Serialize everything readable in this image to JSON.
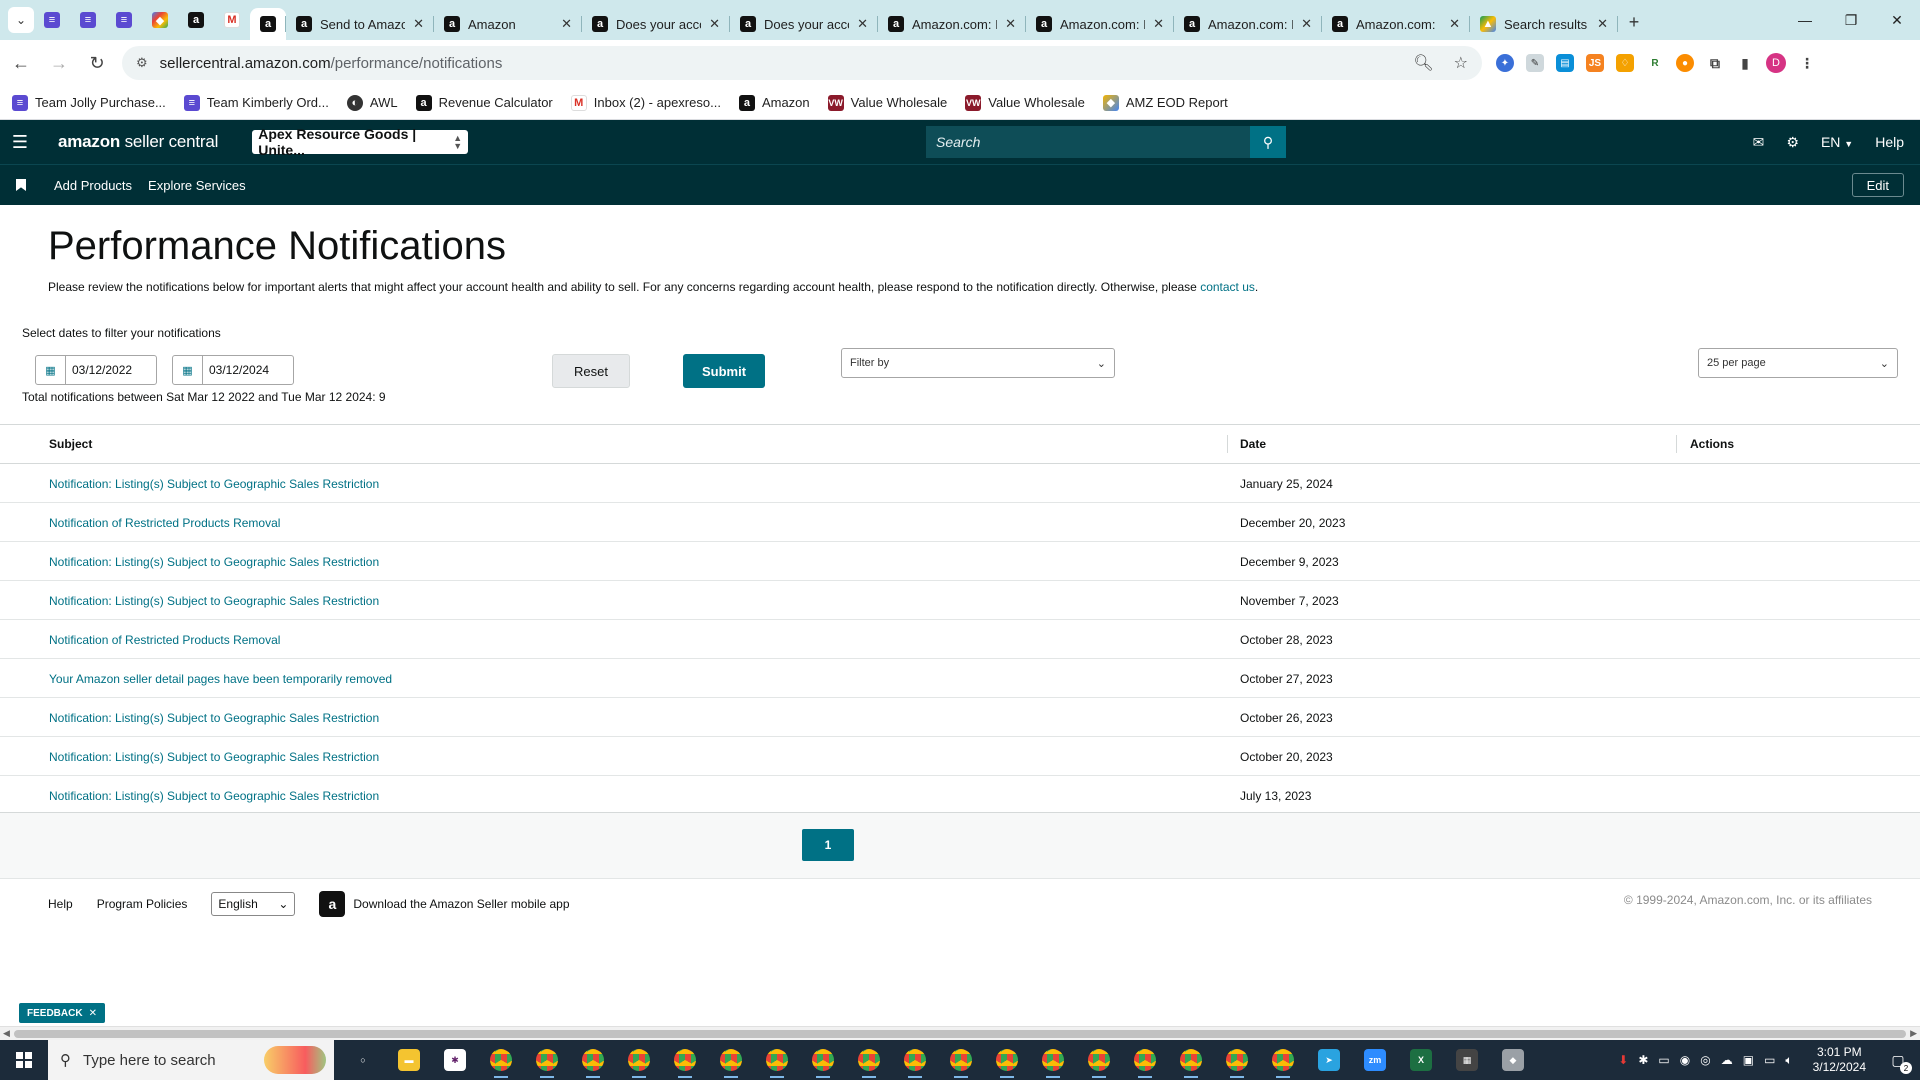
{
  "browser": {
    "tab_menu_icon": "chevron-down-icon",
    "pinned_tabs": [
      "purple-list",
      "purple-list",
      "purple-list",
      "multicolor-app",
      "amazon",
      "gmail"
    ],
    "tabs": [
      {
        "title": "Send to Amazon",
        "icon": "amazon"
      },
      {
        "title": "Amazon",
        "icon": "amazon"
      },
      {
        "title": "Does your acco",
        "icon": "amazon"
      },
      {
        "title": "Does your acco",
        "icon": "amazon"
      },
      {
        "title": "Amazon.com: I",
        "icon": "amazon"
      },
      {
        "title": "Amazon.com: I",
        "icon": "amazon"
      },
      {
        "title": "Amazon.com: I",
        "icon": "amazon"
      },
      {
        "title": "Amazon.com:",
        "icon": "amazon"
      },
      {
        "title": "Search results",
        "icon": "drive"
      }
    ],
    "url_host": "sellercentral.amazon.com",
    "url_path": "/performance/notifications",
    "profile_initial": "D",
    "bookmarks": [
      {
        "label": "Team Jolly Purchase...",
        "icon": "purple"
      },
      {
        "label": "Team Kimberly Ord...",
        "icon": "purple"
      },
      {
        "label": "AWL",
        "icon": "awl"
      },
      {
        "label": "Revenue Calculator",
        "icon": "amz"
      },
      {
        "label": "Inbox (2) - apexreso...",
        "icon": "gmail"
      },
      {
        "label": "Amazon",
        "icon": "amz"
      },
      {
        "label": "Value Wholesale",
        "icon": "vw"
      },
      {
        "label": "Value Wholesale",
        "icon": "vw"
      },
      {
        "label": "AMZ EOD Report",
        "icon": "eod"
      }
    ]
  },
  "header": {
    "logo_bold": "amazon",
    "logo_rest": " seller central",
    "store": "Apex Resource Goods | Unite...",
    "search_placeholder": "Search",
    "lang": "EN",
    "help": "Help",
    "subnav": [
      "Add Products",
      "Explore Services"
    ],
    "edit": "Edit"
  },
  "page": {
    "title": "Performance Notifications",
    "description": "Please review the notifications below for important alerts that might affect your account health and ability to sell. For any concerns regarding account health, please respond to the notification directly. Otherwise, please ",
    "contact_link": "contact us",
    "description_end": ".",
    "filter_label": "Select dates to filter your notifications",
    "date_from": "03/12/2022",
    "date_to": "03/12/2024",
    "total_text": "Total notifications between Sat Mar 12 2022 and Tue Mar 12 2024: 9",
    "reset": "Reset",
    "submit": "Submit",
    "filter_placeholder": "Filter by",
    "per_page": "25 per page"
  },
  "table": {
    "headers": {
      "subject": "Subject",
      "date": "Date",
      "actions": "Actions"
    },
    "rows": [
      {
        "subject": "Notification: Listing(s) Subject to Geographic Sales Restriction",
        "date": "January 25, 2024"
      },
      {
        "subject": "Notification of Restricted Products Removal",
        "date": "December 20, 2023"
      },
      {
        "subject": "Notification: Listing(s) Subject to Geographic Sales Restriction",
        "date": "December 9, 2023"
      },
      {
        "subject": "Notification: Listing(s) Subject to Geographic Sales Restriction",
        "date": "November 7, 2023"
      },
      {
        "subject": "Notification of Restricted Products Removal",
        "date": "October 28, 2023"
      },
      {
        "subject": "Your Amazon seller detail pages have been temporarily removed",
        "date": "October 27, 2023"
      },
      {
        "subject": "Notification: Listing(s) Subject to Geographic Sales Restriction",
        "date": "October 26, 2023"
      },
      {
        "subject": "Notification: Listing(s) Subject to Geographic Sales Restriction",
        "date": "October 20, 2023"
      },
      {
        "subject": "Notification: Listing(s) Subject to Geographic Sales Restriction",
        "date": "July 13, 2023"
      }
    ],
    "current_page": "1"
  },
  "footer": {
    "help": "Help",
    "policies": "Program Policies",
    "language": "English",
    "app_download": "Download the Amazon Seller mobile app",
    "copyright": "© 1999-2024, Amazon.com, Inc. or its affiliates"
  },
  "feedback": "FEEDBACK",
  "taskbar": {
    "search_placeholder": "Type here to search",
    "time": "3:01 PM",
    "date": "3/12/2024",
    "notification_count": "2"
  },
  "colors": {
    "header_bg": "#002f36",
    "accent": "#007185",
    "tab_strip": "#cfe8ec"
  }
}
